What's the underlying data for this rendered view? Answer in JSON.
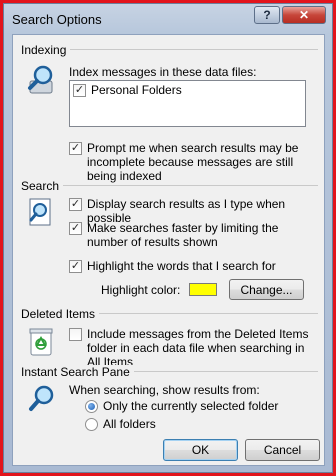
{
  "window": {
    "title": "Search Options",
    "help_label": "?",
    "close_label": "✕"
  },
  "indexing": {
    "label": "Indexing",
    "index_label": "Index messages in these data files:",
    "data_files": [
      {
        "label": "Personal Folders",
        "checked": true
      }
    ],
    "prompt_label": "Prompt me when search results may be incomplete because messages are still being indexed",
    "prompt_checked": true
  },
  "search": {
    "label": "Search",
    "options": [
      {
        "label": "Display search results as I type when possible",
        "checked": true
      },
      {
        "label": "Make searches faster by limiting the number of results shown",
        "checked": true
      },
      {
        "label": "Highlight the words that I search for",
        "checked": true
      }
    ],
    "highlight_color_label": "Highlight color:",
    "highlight_color": "#ffff00",
    "change_label": "Change..."
  },
  "deleted_items": {
    "label": "Deleted Items",
    "include_label": "Include messages from the Deleted Items folder in each data file when searching in All Items",
    "include_checked": false
  },
  "instant_search": {
    "label": "Instant Search Pane",
    "when_label": "When searching, show results from:",
    "options": [
      {
        "label": "Only the currently selected folder",
        "selected": true
      },
      {
        "label": "All folders",
        "selected": false
      }
    ]
  },
  "footer": {
    "ok_label": "OK",
    "cancel_label": "Cancel"
  },
  "colors": {
    "frame_red": "#e2141c",
    "dialog_bg": "#f0f0f0",
    "close_red": "#c7463a"
  }
}
